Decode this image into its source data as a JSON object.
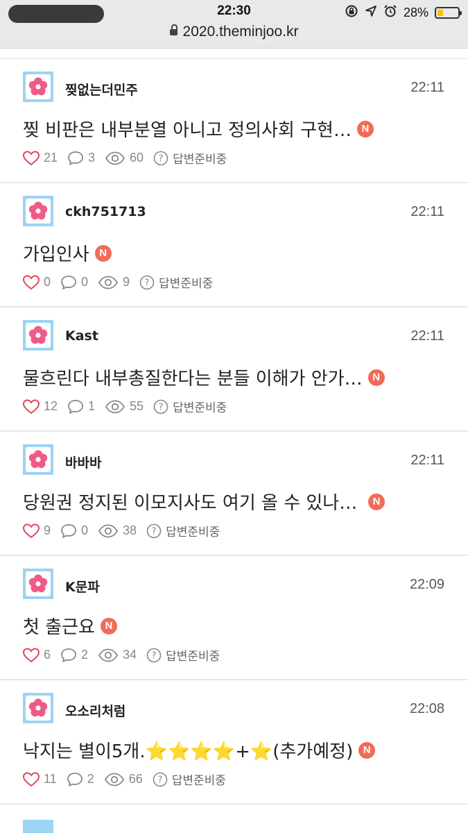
{
  "status_bar": {
    "time": "22:30",
    "url": "2020.theminjoo.kr",
    "battery_percent": "28%",
    "battery_level": 0.28,
    "icons": [
      "screen-rotation-lock-icon",
      "location-arrow-icon",
      "alarm-clock-icon",
      "battery-icon"
    ]
  },
  "colors": {
    "badge": "#f26b57",
    "heart": "#e0475b",
    "avatar_frame": "#9dd3f3",
    "flower": "#ef5b87"
  },
  "posts": [
    {
      "nick": "찢없는더민주",
      "time": "22:11",
      "title": "찢 비판은 내부분열 아니고 정의사회 구현…",
      "badge": "N",
      "likes": "21",
      "comments": "3",
      "views": "60",
      "status": "답변준비중"
    },
    {
      "nick": "ckh751713",
      "time": "22:11",
      "title": "가입인사",
      "badge": "N",
      "likes": "0",
      "comments": "0",
      "views": "9",
      "status": "답변준비중"
    },
    {
      "nick": "Kast",
      "time": "22:11",
      "title": "물흐린다 내부총질한다는 분들 이해가 안가…",
      "badge": "N",
      "likes": "12",
      "comments": "1",
      "views": "55",
      "status": "답변준비중"
    },
    {
      "nick": "바바바",
      "time": "22:11",
      "title": "당원권 정지된 이모지사도 여기 올 수 있나요?",
      "badge": "N",
      "likes": "9",
      "comments": "0",
      "views": "38",
      "status": "답변준비중"
    },
    {
      "nick": "K문파",
      "time": "22:09",
      "title": "첫 출근요",
      "badge": "N",
      "likes": "6",
      "comments": "2",
      "views": "34",
      "status": "답변준비중"
    },
    {
      "nick": "오소리처럼",
      "time": "22:08",
      "title": "낙지는 별이5개.⭐⭐⭐⭐+⭐(추가예정)",
      "badge": "N",
      "likes": "11",
      "comments": "2",
      "views": "66",
      "status": "답변준비중"
    }
  ]
}
